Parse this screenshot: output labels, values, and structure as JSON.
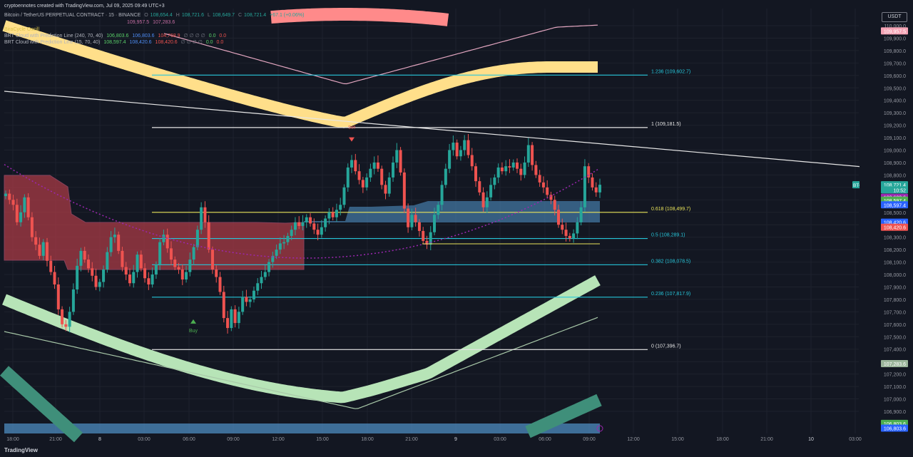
{
  "header": {
    "credit": "cryptoennotes created with TradingView.com, Jul 09, 2025 09:49 UTC+3",
    "symbol": "Bitcoin / TetherUS PERPETUAL CONTRACT · 15 · BINANCE",
    "ohlc": {
      "o_label": "O",
      "o": "108,654.4",
      "h_label": "H",
      "h": "108,721.6",
      "l_label": "L",
      "l": "108,649.7",
      "c_label": "C",
      "c": "108,721.4",
      "change": "+67.1 (+0.06%)"
    },
    "line2_values": [
      "109,957.5",
      "107,283.6"
    ],
    "line3": "BiraCycle Oscill",
    "ind1": {
      "name": "BRT Cloud with Prediction Line (240, 70, 40)",
      "values": [
        "106,803.6",
        "106,803.6",
        "104,768.9",
        "0.0",
        "0.0"
      ]
    },
    "ind2": {
      "name": "BRT Cloud with Prediction Line (15, 70, 40)",
      "values": [
        "108,597.4",
        "108,420.6",
        "108,420.6",
        "0.0",
        "0.0"
      ]
    },
    "na_glyphs": "∅ ∅ ∅ ∅"
  },
  "currency": "USDT",
  "footer": {
    "brand": "TradingView"
  },
  "colors": {
    "bg": "#131722",
    "grid": "#1e222d",
    "up": "#26a69a",
    "down": "#ef5350",
    "fib": "#26c6da",
    "fib618": "#e8e35a",
    "white": "#e6e6e6",
    "yellow_band": "#ffdf8a",
    "pink_band": "#ff8a8a",
    "green_band": "#b7e4b7",
    "teal_band": "#3f8f7a",
    "blue_band": "#4a84b6",
    "red_cloud": "#a83a45",
    "purple_dot": "#9c27b0"
  },
  "chart_data": {
    "type": "candlestick",
    "symbol": "BTCUSDT.P",
    "timeframe": "15",
    "ylim": [
      106700,
      110200
    ],
    "y_ticks": [
      106900,
      107000,
      107100,
      107200,
      107300,
      107400,
      107500,
      107600,
      107700,
      107800,
      107900,
      108000,
      108100,
      108200,
      108300,
      108400,
      108500,
      108600,
      108700,
      108800,
      108900,
      109000,
      109100,
      109200,
      109300,
      109400,
      109500,
      109600,
      109700,
      109800,
      109900,
      110000
    ],
    "x_ticks": [
      "18:00",
      "21:00",
      "8",
      "03:00",
      "06:00",
      "09:00",
      "12:00",
      "15:00",
      "18:00",
      "21:00",
      "9",
      "03:00",
      "06:00",
      "09:00",
      "12:00",
      "15:00",
      "18:00",
      "21:00",
      "10",
      "03:00"
    ],
    "price_labels": [
      {
        "text": "109,957.5",
        "price": 109957.5,
        "color": "#f5a3b5"
      },
      {
        "text": "108,721.4",
        "price": 108721.4,
        "color": "#26a69a"
      },
      {
        "text": "10:52",
        "price": 108680,
        "color": "#26a69a"
      },
      {
        "text": "108,620.6",
        "price": 108620.6,
        "color": "#9c27b0"
      },
      {
        "text": "108,597.4",
        "price": 108597.4,
        "color": "#4caf50"
      },
      {
        "text": "108,597.4",
        "price": 108560,
        "color": "#2962ff"
      },
      {
        "text": "108,420.6",
        "price": 108420.6,
        "color": "#2962ff"
      },
      {
        "text": "108,420.6",
        "price": 108380,
        "color": "#ef5350"
      },
      {
        "text": "107,283.6",
        "price": 107283.6,
        "color": "#9bb59b"
      },
      {
        "text": "106,803.6",
        "price": 106803.6,
        "color": "#4caf50"
      },
      {
        "text": "106,803.6",
        "price": 106765,
        "color": "#2962ff"
      }
    ],
    "fib_levels": [
      {
        "ratio": "1.236",
        "price": 109602.7,
        "label": "1.236 (109,602.7)"
      },
      {
        "ratio": "1",
        "price": 109181.5,
        "label": "1 (109,181.5)"
      },
      {
        "ratio": "0.618",
        "price": 108499.7,
        "label": "0.618 (108,499.7)"
      },
      {
        "ratio": "0.5",
        "price": 108289.1,
        "label": "0.5 (108,289.1)"
      },
      {
        "ratio": "0.382",
        "price": 108078.5,
        "label": "0.382 (108,078.5)"
      },
      {
        "ratio": "0.236",
        "price": 107817.9,
        "label": "0.236 (107,817.9)"
      },
      {
        "ratio": "0",
        "price": 107396.7,
        "label": "0 (107,396.7)"
      }
    ],
    "signals": [
      {
        "type": "buy",
        "label": "Buy",
        "price": 107640
      },
      {
        "type": "sell",
        "label": "Sell",
        "price": 109160
      }
    ],
    "closes": [
      108650,
      108600,
      108560,
      108420,
      108500,
      108620,
      108460,
      108300,
      108240,
      108150,
      108260,
      108110,
      108020,
      107920,
      107720,
      107600,
      107580,
      107700,
      107880,
      108070,
      108190,
      108120,
      108050,
      107990,
      107900,
      107940,
      108040,
      108180,
      108300,
      108320,
      108190,
      108060,
      108000,
      107930,
      108020,
      108160,
      108050,
      107970,
      107920,
      108000,
      108080,
      108260,
      108320,
      108210,
      108120,
      108060,
      108040,
      107960,
      108020,
      108120,
      108220,
      108360,
      108540,
      108420,
      108200,
      108040,
      107980,
      107860,
      107650,
      107570,
      107720,
      107610,
      107700,
      107820,
      107780,
      107800,
      107870,
      107930,
      107980,
      108020,
      108100,
      108150,
      108200,
      108250,
      108260,
      108310,
      108360,
      108420,
      108390,
      108420,
      108460,
      108410,
      108360,
      108320,
      108380,
      108450,
      108500,
      108460,
      108520,
      108560,
      108700,
      108860,
      108920,
      108830,
      108760,
      108700,
      108780,
      108850,
      108900,
      108850,
      108720,
      108650,
      108780,
      108900,
      109000,
      108820,
      108530,
      108380,
      108480,
      108420,
      108350,
      108270,
      108240,
      108340,
      108480,
      108560,
      108720,
      108850,
      109000,
      109060,
      108950,
      109000,
      109080,
      108960,
      108870,
      108750,
      108660,
      108540,
      108620,
      108720,
      108780,
      108860,
      108830,
      108870,
      108860,
      108900,
      108850,
      108800,
      108900,
      109040,
      108880,
      108800,
      108740,
      108700,
      108640,
      108600,
      108520,
      108400,
      108360,
      108310,
      108290,
      108330,
      108420,
      108540,
      108870,
      108780,
      108700,
      108660,
      108721.4
    ]
  }
}
